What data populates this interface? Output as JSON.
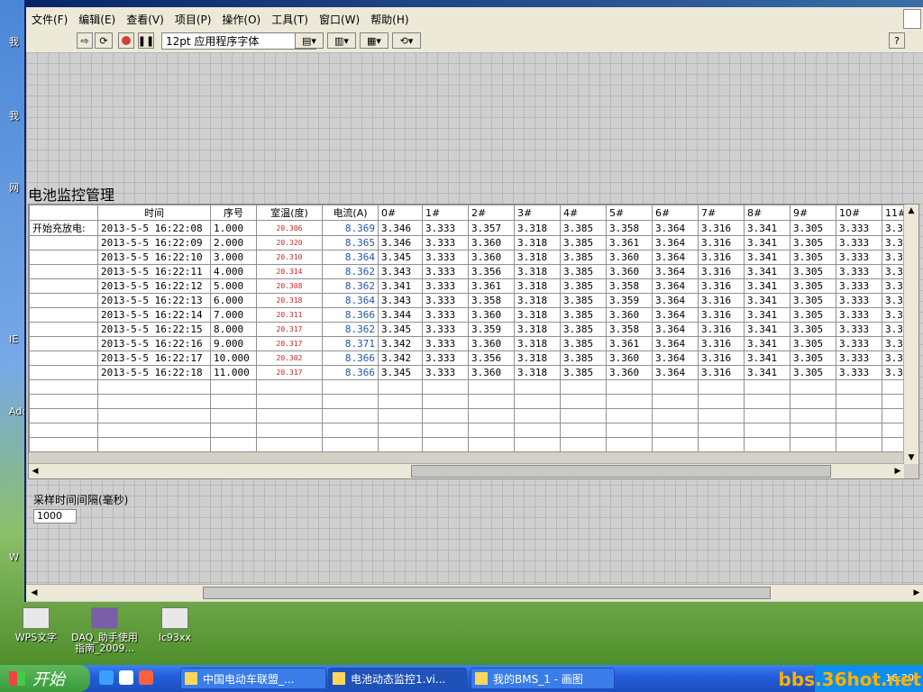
{
  "window": {
    "menu": [
      "文件(F)",
      "编辑(E)",
      "查看(V)",
      "项目(P)",
      "操作(O)",
      "工具(T)",
      "窗口(W)",
      "帮助(H)"
    ],
    "font_select": "12pt 应用程序字体",
    "help_button": "?"
  },
  "panel": {
    "title": "电池监控管理",
    "row_label": "开始充放电:",
    "columns": [
      "时间",
      "序号",
      "室温(度)",
      "电流(A)",
      "0#",
      "1#",
      "2#",
      "3#",
      "4#",
      "5#",
      "6#",
      "7#",
      "8#",
      "9#",
      "10#",
      "11#"
    ],
    "rows": [
      [
        "2013-5-5 16:22:08",
        "1.000",
        "20.306",
        "8.369",
        "3.346",
        "3.333",
        "3.357",
        "3.318",
        "3.385",
        "3.358",
        "3.364",
        "3.316",
        "3.341",
        "3.305",
        "3.333",
        "3.3"
      ],
      [
        "2013-5-5 16:22:09",
        "2.000",
        "20.320",
        "8.365",
        "3.346",
        "3.333",
        "3.360",
        "3.318",
        "3.385",
        "3.361",
        "3.364",
        "3.316",
        "3.341",
        "3.305",
        "3.333",
        "3.3"
      ],
      [
        "2013-5-5 16:22:10",
        "3.000",
        "20.310",
        "8.364",
        "3.345",
        "3.333",
        "3.360",
        "3.318",
        "3.385",
        "3.360",
        "3.364",
        "3.316",
        "3.341",
        "3.305",
        "3.333",
        "3.3"
      ],
      [
        "2013-5-5 16:22:11",
        "4.000",
        "20.314",
        "8.362",
        "3.343",
        "3.333",
        "3.356",
        "3.318",
        "3.385",
        "3.360",
        "3.364",
        "3.316",
        "3.341",
        "3.305",
        "3.333",
        "3.3"
      ],
      [
        "2013-5-5 16:22:12",
        "5.000",
        "20.308",
        "8.362",
        "3.341",
        "3.333",
        "3.361",
        "3.318",
        "3.385",
        "3.358",
        "3.364",
        "3.316",
        "3.341",
        "3.305",
        "3.333",
        "3.3"
      ],
      [
        "2013-5-5 16:22:13",
        "6.000",
        "20.318",
        "8.364",
        "3.343",
        "3.333",
        "3.358",
        "3.318",
        "3.385",
        "3.359",
        "3.364",
        "3.316",
        "3.341",
        "3.305",
        "3.333",
        "3.3"
      ],
      [
        "2013-5-5 16:22:14",
        "7.000",
        "20.311",
        "8.366",
        "3.344",
        "3.333",
        "3.360",
        "3.318",
        "3.385",
        "3.360",
        "3.364",
        "3.316",
        "3.341",
        "3.305",
        "3.333",
        "3.3"
      ],
      [
        "2013-5-5 16:22:15",
        "8.000",
        "20.317",
        "8.362",
        "3.345",
        "3.333",
        "3.359",
        "3.318",
        "3.385",
        "3.358",
        "3.364",
        "3.316",
        "3.341",
        "3.305",
        "3.333",
        "3.3"
      ],
      [
        "2013-5-5 16:22:16",
        "9.000",
        "20.317",
        "8.371",
        "3.342",
        "3.333",
        "3.360",
        "3.318",
        "3.385",
        "3.361",
        "3.364",
        "3.316",
        "3.341",
        "3.305",
        "3.333",
        "3.3"
      ],
      [
        "2013-5-5 16:22:17",
        "10.000",
        "20.302",
        "8.366",
        "3.342",
        "3.333",
        "3.356",
        "3.318",
        "3.385",
        "3.360",
        "3.364",
        "3.316",
        "3.341",
        "3.305",
        "3.333",
        "3.3"
      ],
      [
        "2013-5-5 16:22:18",
        "11.000",
        "20.317",
        "8.366",
        "3.345",
        "3.333",
        "3.360",
        "3.318",
        "3.385",
        "3.360",
        "3.364",
        "3.316",
        "3.341",
        "3.305",
        "3.333",
        "3.3"
      ]
    ],
    "empty_rows": 5,
    "interval_label": "采样时间间隔(毫秒)",
    "interval_value": "1000"
  },
  "desktop": {
    "left_labels": [
      "我",
      "我",
      "网",
      "IE",
      "Adob",
      "W"
    ],
    "icons": [
      {
        "label": "WPS文字"
      },
      {
        "label": "DAQ_助手使用指南_2009..."
      },
      {
        "label": "lc93xx"
      }
    ]
  },
  "taskbar": {
    "start_label": "开始",
    "tasks": [
      "中国电动车联盟_...",
      "电池动态监控1.vi...",
      "我的BMS_1 - 画图"
    ],
    "clock": "16:20",
    "watermark": "bbs.36hot.net"
  },
  "colors": {
    "temp_text": "#cc2222",
    "current_text": "#2255aa",
    "taskbar": "#245edc"
  }
}
